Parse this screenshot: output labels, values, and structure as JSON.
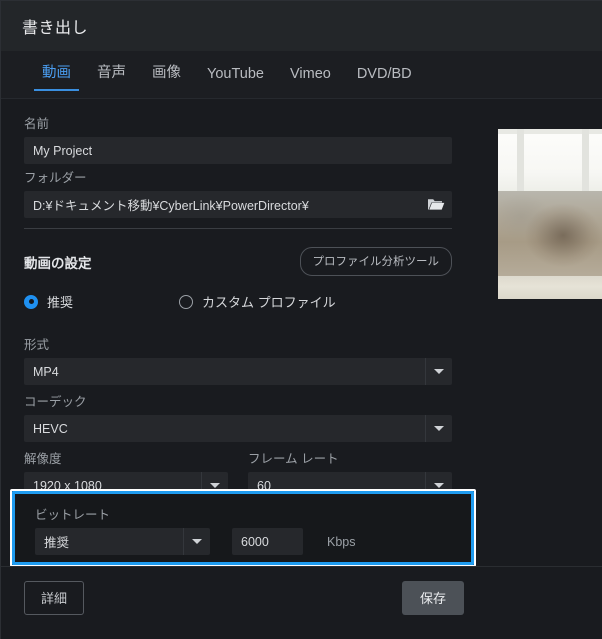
{
  "window": {
    "title": "書き出し"
  },
  "tabs": [
    {
      "label": "動画",
      "active": true
    },
    {
      "label": "音声",
      "active": false
    },
    {
      "label": "画像",
      "active": false
    },
    {
      "label": "YouTube",
      "active": false
    },
    {
      "label": "Vimeo",
      "active": false
    },
    {
      "label": "DVD/BD",
      "active": false
    }
  ],
  "fields": {
    "name_label": "名前",
    "name_value": "My Project",
    "folder_label": "フォルダー",
    "folder_value": "D:¥ドキュメント移動¥CyberLink¥PowerDirector¥",
    "folder_icon": "folder-open-icon"
  },
  "video_section": {
    "title": "動画の設定",
    "analyze_button": "プロファイル分析ツール",
    "radios": [
      {
        "label": "推奨",
        "checked": true
      },
      {
        "label": "カスタム プロファイル",
        "checked": false
      }
    ],
    "format_label": "形式",
    "format_value": "MP4",
    "codec_label": "コーデック",
    "codec_value": "HEVC",
    "resolution_label": "解像度",
    "resolution_value": "1920 x 1080",
    "framerate_label": "フレーム レート",
    "framerate_value": "60",
    "bitrate_label": "ビットレート",
    "bitrate_mode": "推奨",
    "bitrate_value": "6000",
    "bitrate_unit": "Kbps"
  },
  "footer": {
    "detail_button": "詳細",
    "save_button": "保存"
  },
  "colors": {
    "accent": "#1f9cf0",
    "tab_active": "#4a9df0",
    "highlight_border": "#1f9cf0",
    "window_bg": "#191b1f",
    "input_bg": "#26282c"
  }
}
